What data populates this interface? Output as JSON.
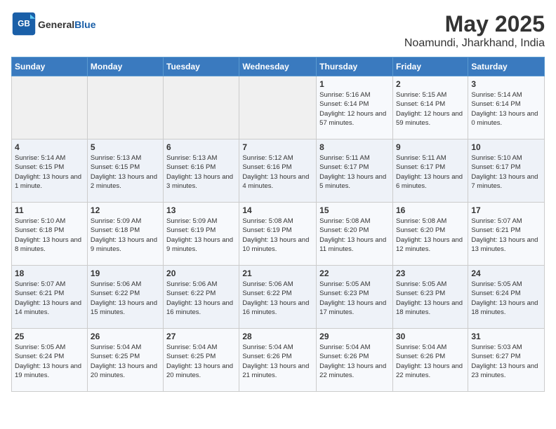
{
  "header": {
    "logo_general": "General",
    "logo_blue": "Blue",
    "title": "May 2025",
    "subtitle": "Noamundi, Jharkhand, India"
  },
  "weekdays": [
    "Sunday",
    "Monday",
    "Tuesday",
    "Wednesday",
    "Thursday",
    "Friday",
    "Saturday"
  ],
  "weeks": [
    [
      {
        "day": "",
        "info": ""
      },
      {
        "day": "",
        "info": ""
      },
      {
        "day": "",
        "info": ""
      },
      {
        "day": "",
        "info": ""
      },
      {
        "day": "1",
        "info": "Sunrise: 5:16 AM\nSunset: 6:14 PM\nDaylight: 12 hours and 57 minutes."
      },
      {
        "day": "2",
        "info": "Sunrise: 5:15 AM\nSunset: 6:14 PM\nDaylight: 12 hours and 59 minutes."
      },
      {
        "day": "3",
        "info": "Sunrise: 5:14 AM\nSunset: 6:14 PM\nDaylight: 13 hours and 0 minutes."
      }
    ],
    [
      {
        "day": "4",
        "info": "Sunrise: 5:14 AM\nSunset: 6:15 PM\nDaylight: 13 hours and 1 minute."
      },
      {
        "day": "5",
        "info": "Sunrise: 5:13 AM\nSunset: 6:15 PM\nDaylight: 13 hours and 2 minutes."
      },
      {
        "day": "6",
        "info": "Sunrise: 5:13 AM\nSunset: 6:16 PM\nDaylight: 13 hours and 3 minutes."
      },
      {
        "day": "7",
        "info": "Sunrise: 5:12 AM\nSunset: 6:16 PM\nDaylight: 13 hours and 4 minutes."
      },
      {
        "day": "8",
        "info": "Sunrise: 5:11 AM\nSunset: 6:17 PM\nDaylight: 13 hours and 5 minutes."
      },
      {
        "day": "9",
        "info": "Sunrise: 5:11 AM\nSunset: 6:17 PM\nDaylight: 13 hours and 6 minutes."
      },
      {
        "day": "10",
        "info": "Sunrise: 5:10 AM\nSunset: 6:17 PM\nDaylight: 13 hours and 7 minutes."
      }
    ],
    [
      {
        "day": "11",
        "info": "Sunrise: 5:10 AM\nSunset: 6:18 PM\nDaylight: 13 hours and 8 minutes."
      },
      {
        "day": "12",
        "info": "Sunrise: 5:09 AM\nSunset: 6:18 PM\nDaylight: 13 hours and 9 minutes."
      },
      {
        "day": "13",
        "info": "Sunrise: 5:09 AM\nSunset: 6:19 PM\nDaylight: 13 hours and 9 minutes."
      },
      {
        "day": "14",
        "info": "Sunrise: 5:08 AM\nSunset: 6:19 PM\nDaylight: 13 hours and 10 minutes."
      },
      {
        "day": "15",
        "info": "Sunrise: 5:08 AM\nSunset: 6:20 PM\nDaylight: 13 hours and 11 minutes."
      },
      {
        "day": "16",
        "info": "Sunrise: 5:08 AM\nSunset: 6:20 PM\nDaylight: 13 hours and 12 minutes."
      },
      {
        "day": "17",
        "info": "Sunrise: 5:07 AM\nSunset: 6:21 PM\nDaylight: 13 hours and 13 minutes."
      }
    ],
    [
      {
        "day": "18",
        "info": "Sunrise: 5:07 AM\nSunset: 6:21 PM\nDaylight: 13 hours and 14 minutes."
      },
      {
        "day": "19",
        "info": "Sunrise: 5:06 AM\nSunset: 6:22 PM\nDaylight: 13 hours and 15 minutes."
      },
      {
        "day": "20",
        "info": "Sunrise: 5:06 AM\nSunset: 6:22 PM\nDaylight: 13 hours and 16 minutes."
      },
      {
        "day": "21",
        "info": "Sunrise: 5:06 AM\nSunset: 6:22 PM\nDaylight: 13 hours and 16 minutes."
      },
      {
        "day": "22",
        "info": "Sunrise: 5:05 AM\nSunset: 6:23 PM\nDaylight: 13 hours and 17 minutes."
      },
      {
        "day": "23",
        "info": "Sunrise: 5:05 AM\nSunset: 6:23 PM\nDaylight: 13 hours and 18 minutes."
      },
      {
        "day": "24",
        "info": "Sunrise: 5:05 AM\nSunset: 6:24 PM\nDaylight: 13 hours and 18 minutes."
      }
    ],
    [
      {
        "day": "25",
        "info": "Sunrise: 5:05 AM\nSunset: 6:24 PM\nDaylight: 13 hours and 19 minutes."
      },
      {
        "day": "26",
        "info": "Sunrise: 5:04 AM\nSunset: 6:25 PM\nDaylight: 13 hours and 20 minutes."
      },
      {
        "day": "27",
        "info": "Sunrise: 5:04 AM\nSunset: 6:25 PM\nDaylight: 13 hours and 20 minutes."
      },
      {
        "day": "28",
        "info": "Sunrise: 5:04 AM\nSunset: 6:26 PM\nDaylight: 13 hours and 21 minutes."
      },
      {
        "day": "29",
        "info": "Sunrise: 5:04 AM\nSunset: 6:26 PM\nDaylight: 13 hours and 22 minutes."
      },
      {
        "day": "30",
        "info": "Sunrise: 5:04 AM\nSunset: 6:26 PM\nDaylight: 13 hours and 22 minutes."
      },
      {
        "day": "31",
        "info": "Sunrise: 5:03 AM\nSunset: 6:27 PM\nDaylight: 13 hours and 23 minutes."
      }
    ]
  ]
}
